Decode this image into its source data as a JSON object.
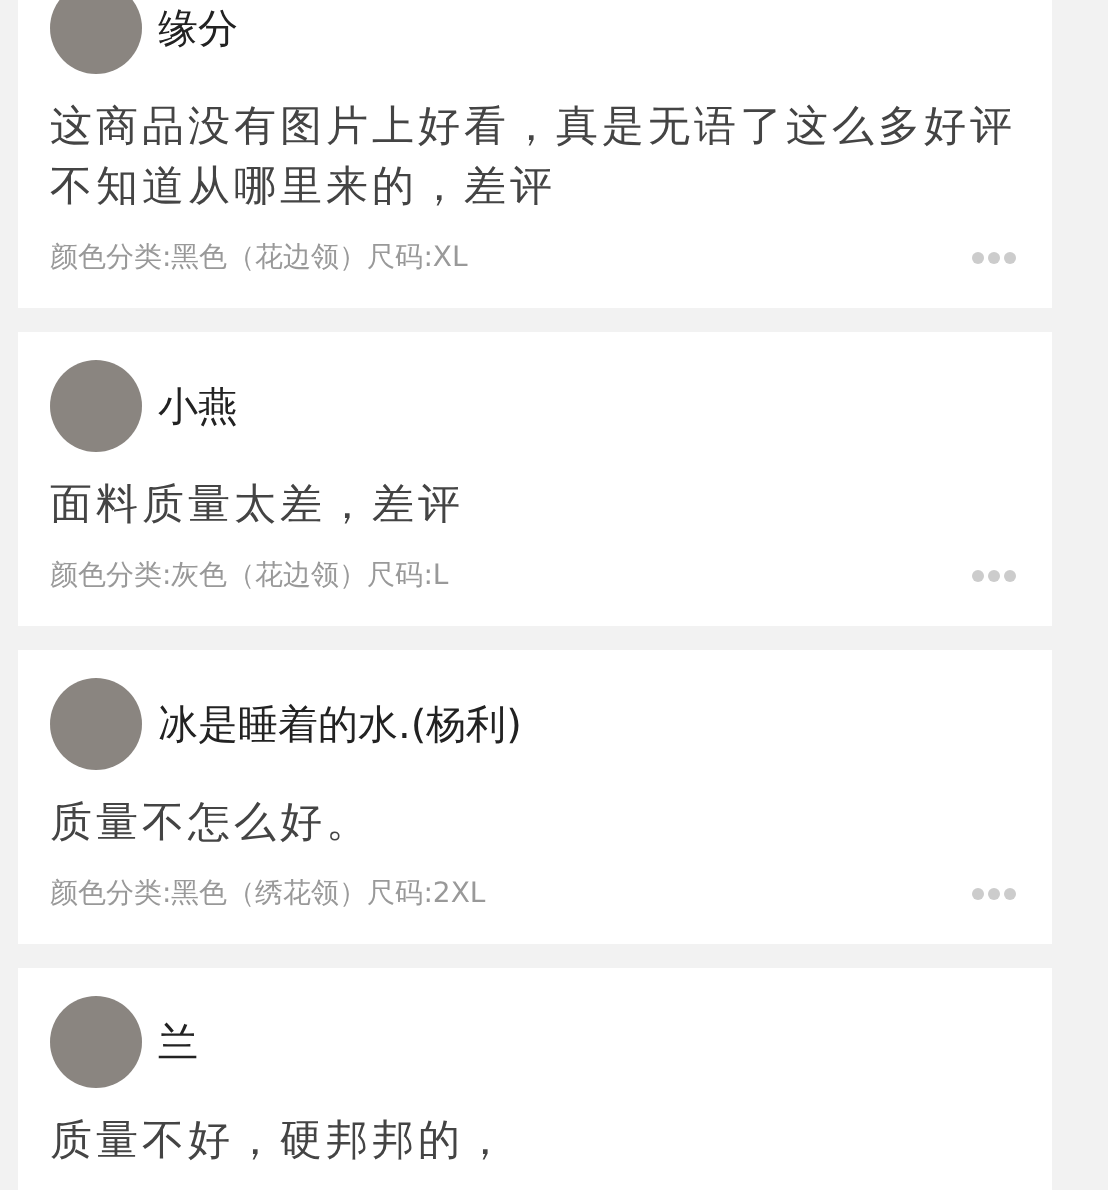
{
  "reviews": [
    {
      "name": "缘分",
      "comment": "这商品没有图片上好看，真是无语了这么多好评不知道从哪里来的，差评",
      "spec": "颜色分类:黑色（花边领）尺码:XL"
    },
    {
      "name": "小燕",
      "comment": "面料质量太差，差评",
      "spec": "颜色分类:灰色（花边领）尺码:L"
    },
    {
      "name": "冰是睡着的水.(杨利)",
      "comment": "质量不怎么好。",
      "spec": "颜色分类:黑色（绣花领）尺码:2XL"
    },
    {
      "name": "兰",
      "comment": "质量不好，硬邦邦的，"
    }
  ]
}
